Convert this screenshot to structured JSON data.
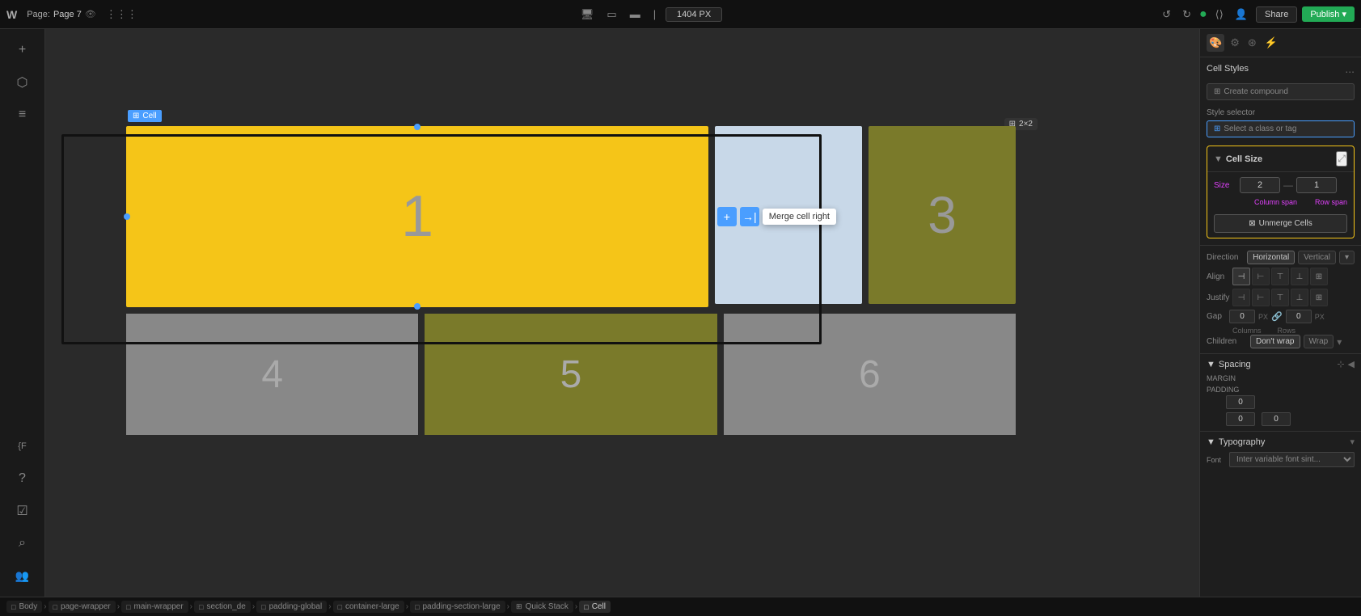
{
  "topbar": {
    "logo": "W",
    "page_label": "Page:",
    "page_name": "Page 7",
    "dimension": "1404 PX",
    "share_label": "Share",
    "publish_label": "Publish ▾"
  },
  "left_sidebar": {
    "icons": [
      {
        "name": "plus-icon",
        "symbol": "+"
      },
      {
        "name": "cube-icon",
        "symbol": "⬡"
      },
      {
        "name": "layers-icon",
        "symbol": "≡"
      },
      {
        "name": "variable-icon",
        "symbol": "{F"
      },
      {
        "name": "help-icon",
        "symbol": "?"
      },
      {
        "name": "checklist-icon",
        "symbol": "☑"
      },
      {
        "name": "search-icon",
        "symbol": "⌕"
      },
      {
        "name": "users-icon",
        "symbol": "👥"
      }
    ]
  },
  "canvas": {
    "cells": [
      {
        "id": 1,
        "label": "1",
        "color": "#f5c518"
      },
      {
        "id": 2,
        "label": "",
        "color": "#c8d8e8"
      },
      {
        "id": 3,
        "label": "3",
        "color": "#7a7a2a"
      },
      {
        "id": 4,
        "label": "4",
        "color": "#888888"
      },
      {
        "id": 5,
        "label": "5",
        "color": "#7a7a2a"
      },
      {
        "id": 6,
        "label": "6",
        "color": "#888888"
      }
    ],
    "selected_cell_label": "Cell",
    "merge_tooltip": "Merge cell right",
    "scale_badge": "2×2"
  },
  "right_panel": {
    "cell_styles_title": "Cell Styles",
    "cell_styles_dots": "...",
    "create_compound_label": "Create compound",
    "style_selector_label": "Style selector",
    "style_selector_placeholder": "Select a class or tag",
    "cell_size": {
      "title": "Cell Size",
      "size_label": "Size",
      "col_value": "2",
      "row_value": "1",
      "col_span_label": "Column span",
      "row_span_label": "Row span",
      "unmerge_label": "Unmerge Cells"
    },
    "direction": {
      "label": "Direction",
      "horizontal": "Horizontal",
      "vertical": "Vertical"
    },
    "align": {
      "label": "Align",
      "icons": [
        "⊣",
        "⊢",
        "⊤",
        "⊥",
        "⊞",
        "⊠"
      ]
    },
    "justify": {
      "label": "Justify",
      "icons": [
        "⊣",
        "⊢",
        "⊤",
        "⊥",
        "⊞",
        "⊠"
      ]
    },
    "gap": {
      "label": "Gap",
      "col_value": "0",
      "row_value": "0",
      "col_unit": "PX",
      "row_unit": "PX",
      "cols_label": "Columns",
      "rows_label": "Rows"
    },
    "children": {
      "label": "Children",
      "dont_wrap": "Don't wrap",
      "wrap": "Wrap"
    },
    "spacing": {
      "title": "Spacing",
      "margin_label": "MARGIN",
      "padding_label": "PADDING",
      "padding_value": "0",
      "top_value": "0",
      "right_value": "0"
    },
    "typography": {
      "title": "Typography",
      "font_label": "Font",
      "font_value": "Inter variable font sint..."
    }
  },
  "breadcrumb": {
    "items": [
      {
        "label": "Body",
        "icon": "□"
      },
      {
        "label": "page-wrapper",
        "icon": "□"
      },
      {
        "label": "main-wrapper",
        "icon": "□"
      },
      {
        "label": "section_de",
        "icon": "□"
      },
      {
        "label": "padding-global",
        "icon": "□"
      },
      {
        "label": "container-large",
        "icon": "□"
      },
      {
        "label": "padding-section-large",
        "icon": "□"
      },
      {
        "label": "Quick Stack",
        "icon": "⊞"
      },
      {
        "label": "Cell",
        "icon": "□",
        "active": true
      }
    ]
  }
}
